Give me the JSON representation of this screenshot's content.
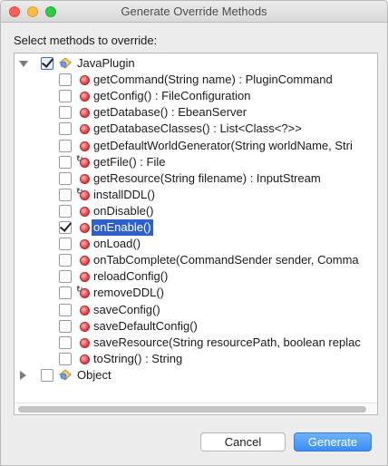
{
  "window": {
    "title": "Generate Override Methods"
  },
  "prompt": "Select methods to override:",
  "tree": {
    "root": {
      "label": "JavaPlugin",
      "checked": true,
      "expanded": true
    },
    "methods": [
      {
        "label": "getCommand(String name) : PluginCommand",
        "checked": false,
        "override": false,
        "selected": false
      },
      {
        "label": "getConfig() : FileConfiguration",
        "checked": false,
        "override": false,
        "selected": false
      },
      {
        "label": "getDatabase() : EbeanServer",
        "checked": false,
        "override": false,
        "selected": false
      },
      {
        "label": "getDatabaseClasses() : List<Class<?>>",
        "checked": false,
        "override": false,
        "selected": false
      },
      {
        "label": "getDefaultWorldGenerator(String worldName, Stri",
        "checked": false,
        "override": false,
        "selected": false
      },
      {
        "label": "getFile() : File",
        "checked": false,
        "override": true,
        "selected": false
      },
      {
        "label": "getResource(String filename) : InputStream",
        "checked": false,
        "override": false,
        "selected": false
      },
      {
        "label": "installDDL()",
        "checked": false,
        "override": true,
        "selected": false
      },
      {
        "label": "onDisable()",
        "checked": false,
        "override": false,
        "selected": false
      },
      {
        "label": "onEnable()",
        "checked": true,
        "override": false,
        "selected": true
      },
      {
        "label": "onLoad()",
        "checked": false,
        "override": false,
        "selected": false
      },
      {
        "label": "onTabComplete(CommandSender sender, Comma",
        "checked": false,
        "override": false,
        "selected": false
      },
      {
        "label": "reloadConfig()",
        "checked": false,
        "override": false,
        "selected": false
      },
      {
        "label": "removeDDL()",
        "checked": false,
        "override": true,
        "selected": false
      },
      {
        "label": "saveConfig()",
        "checked": false,
        "override": false,
        "selected": false
      },
      {
        "label": "saveDefaultConfig()",
        "checked": false,
        "override": false,
        "selected": false
      },
      {
        "label": "saveResource(String resourcePath, boolean replac",
        "checked": false,
        "override": false,
        "selected": false
      },
      {
        "label": "toString() : String",
        "checked": false,
        "override": false,
        "selected": false
      }
    ],
    "second_root": {
      "label": "Object",
      "checked": false,
      "expanded": false
    }
  },
  "buttons": {
    "cancel": "Cancel",
    "generate": "Generate"
  },
  "colors": {
    "selection": "#2f5fc9",
    "primary_button": "#3b8df6",
    "method_icon": "#d9363e"
  }
}
